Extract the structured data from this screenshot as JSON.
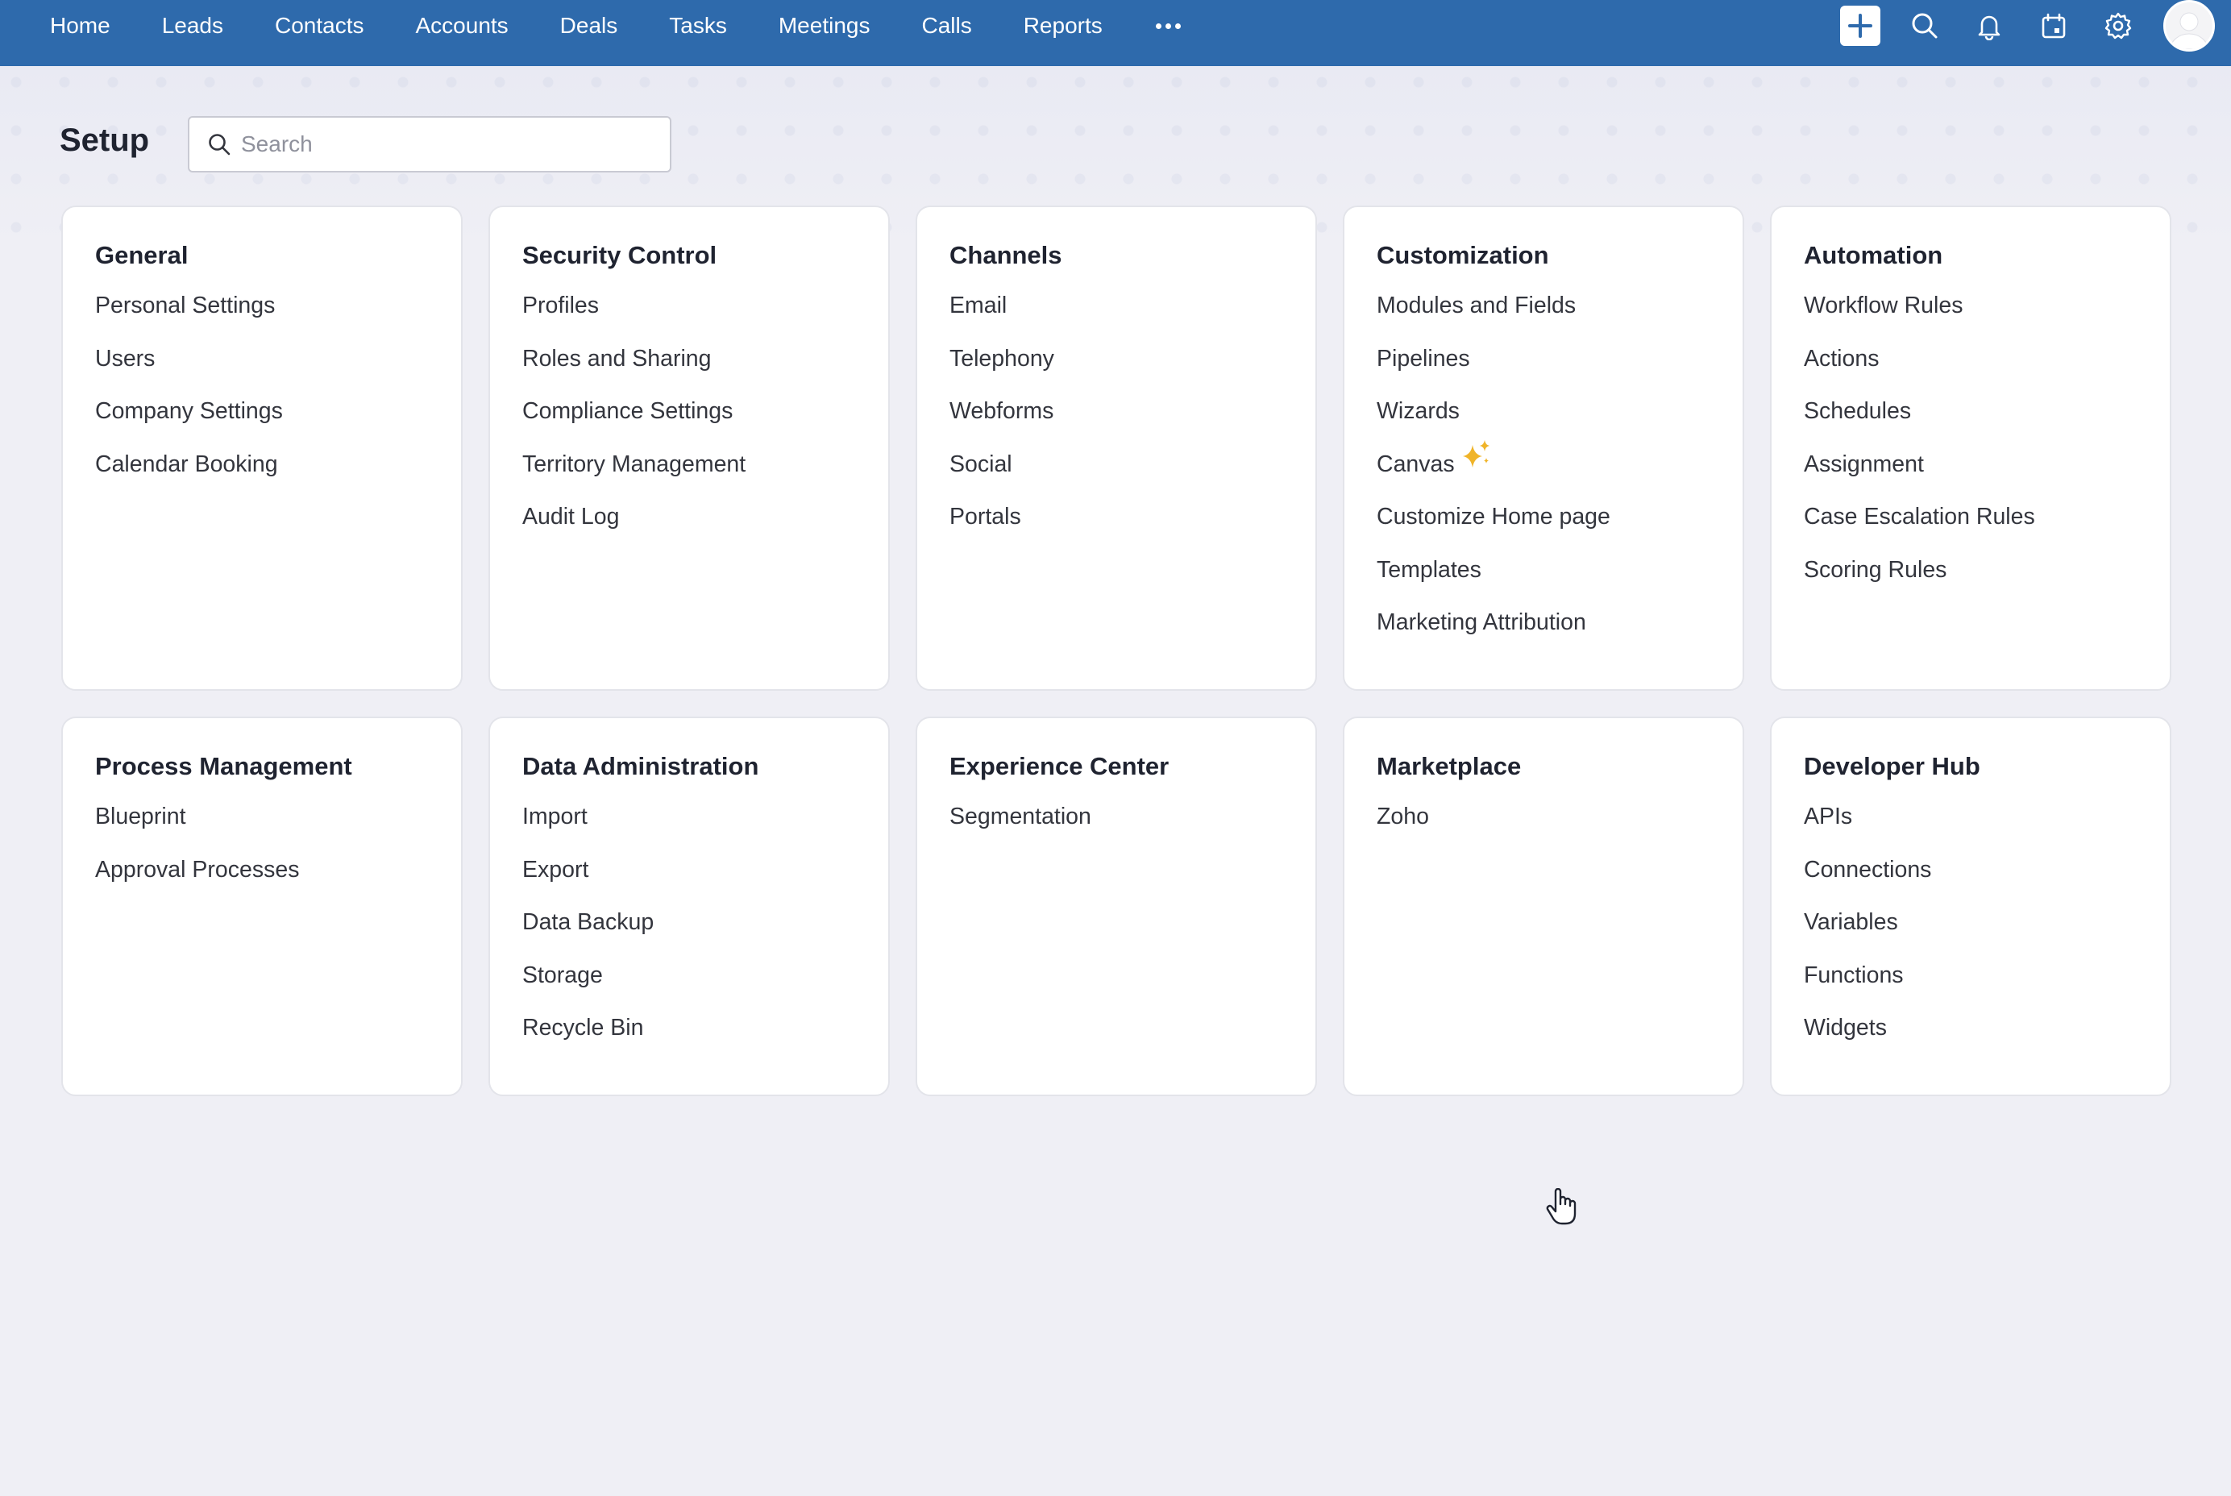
{
  "nav": {
    "tabs": [
      "Home",
      "Leads",
      "Contacts",
      "Accounts",
      "Deals",
      "Tasks",
      "Meetings",
      "Calls",
      "Reports"
    ],
    "more_icon": "more-dots-icon",
    "right_icons": [
      "add-icon",
      "search-icon",
      "bell-icon",
      "calendar-icon",
      "gear-icon",
      "avatar"
    ]
  },
  "colors": {
    "topbar": "#2e6aac",
    "page_bg": "#efeff5",
    "sparkle": "#f0b429"
  },
  "setup": {
    "title": "Setup",
    "search_placeholder": "Search"
  },
  "cards": [
    {
      "title": "General",
      "items": [
        "Personal Settings",
        "Users",
        "Company Settings",
        "Calendar Booking"
      ]
    },
    {
      "title": "Security Control",
      "items": [
        "Profiles",
        "Roles and Sharing",
        "Compliance Settings",
        "Territory Management",
        "Audit Log"
      ]
    },
    {
      "title": "Channels",
      "items": [
        "Email",
        "Telephony",
        "Webforms",
        "Social",
        "Portals"
      ]
    },
    {
      "title": "Customization",
      "items": [
        "Modules and Fields",
        "Pipelines",
        "Wizards",
        "Canvas",
        "Customize Home page",
        "Templates",
        "Marketing Attribution"
      ]
    },
    {
      "title": "Automation",
      "items": [
        "Workflow Rules",
        "Actions",
        "Schedules",
        "Assignment",
        "Case Escalation Rules",
        "Scoring Rules"
      ]
    },
    {
      "title": "Process Management",
      "items": [
        "Blueprint",
        "Approval Processes"
      ]
    },
    {
      "title": "Data Administration",
      "items": [
        "Import",
        "Export",
        "Data Backup",
        "Storage",
        "Recycle Bin"
      ]
    },
    {
      "title": "Experience Center",
      "items": [
        "Segmentation"
      ]
    },
    {
      "title": "Marketplace",
      "items": [
        "Zoho"
      ]
    },
    {
      "title": "Developer Hub",
      "items": [
        "APIs",
        "Connections",
        "Variables",
        "Functions",
        "Widgets"
      ]
    }
  ]
}
